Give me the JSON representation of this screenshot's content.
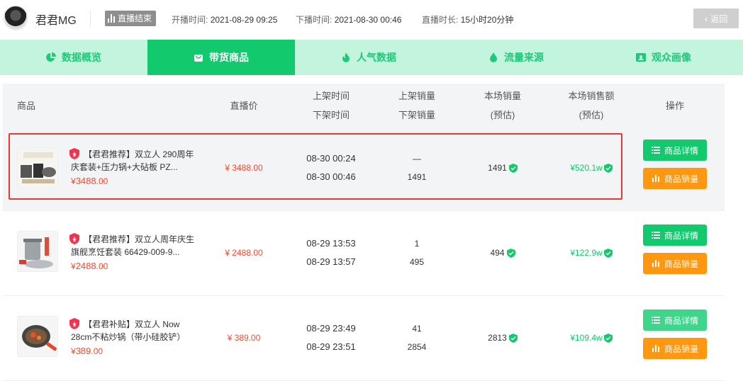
{
  "header": {
    "anchor_name": "君君MG",
    "live_status": "直播结束",
    "start_label": "开播时间:",
    "start_value": "2021-08-29 09:25",
    "end_label": "下播时间:",
    "end_value": "2021-08-30 00:46",
    "duration_label": "直播时长:",
    "duration_value": "15小时20分钟",
    "back_label": "返回"
  },
  "tabs": [
    {
      "label": "数据概览",
      "icon": "pie-chart-icon",
      "active": false
    },
    {
      "label": "带货商品",
      "icon": "shop-bag-icon",
      "active": true
    },
    {
      "label": "人气数据",
      "icon": "flame-icon",
      "active": false
    },
    {
      "label": "流量来源",
      "icon": "droplet-icon",
      "active": false
    },
    {
      "label": "观众画像",
      "icon": "user-card-icon",
      "active": false
    }
  ],
  "table": {
    "headers": {
      "product": "商品",
      "live_price": "直播价",
      "on_time": "上架时间",
      "off_time": "下架时间",
      "on_sales": "上架销量",
      "off_sales": "下架销量",
      "vol_l1": "本场销量",
      "vol_l2": "(预估)",
      "amt_l1": "本场销售额",
      "amt_l2": "(预估)",
      "actions": "操作"
    },
    "rows": [
      {
        "name": "【君君推荐】双立人 290周年庆套装+压力锅+大砧板 PZ...",
        "price_sign": "¥",
        "price_int": "3488",
        "price_dec": ".00",
        "live_price": "¥ 3488.00",
        "on_time": "08-30 00:24",
        "off_time": "08-30 00:46",
        "on_sales": "—",
        "off_sales": "1491",
        "volume": "1491",
        "amount": "¥520.1w",
        "detail_btn": "商品详情",
        "sales_btn": "商品销量"
      },
      {
        "name": "【君君推荐】双立人周年庆生旗舰烹饪套装 66429-009-9...",
        "price_sign": "¥",
        "price_int": "2488",
        "price_dec": ".00",
        "live_price": "¥ 2488.00",
        "on_time": "08-29 13:53",
        "off_time": "08-29 13:57",
        "on_sales": "1",
        "off_sales": "495",
        "volume": "494",
        "amount": "¥122.9w",
        "detail_btn": "商品详情",
        "sales_btn": "商品销量"
      },
      {
        "name": "【君君补贴】双立人 Now 28cm不粘炒锅（带小硅胶铲）",
        "price_sign": "¥",
        "price_int": "389",
        "price_dec": ".00",
        "live_price": "¥ 389.00",
        "on_time": "08-29 23:49",
        "off_time": "08-29 23:51",
        "on_sales": "41",
        "off_sales": "2854",
        "volume": "2813",
        "amount": "¥109.4w",
        "detail_btn": "商品详情",
        "sales_btn": "商品销量"
      }
    ]
  },
  "colors": {
    "accent_green": "#12c96e",
    "tab_bg": "#c3f5de",
    "price_red": "#f5492d",
    "orange": "#ff9711",
    "highlight_border": "#e53935"
  }
}
